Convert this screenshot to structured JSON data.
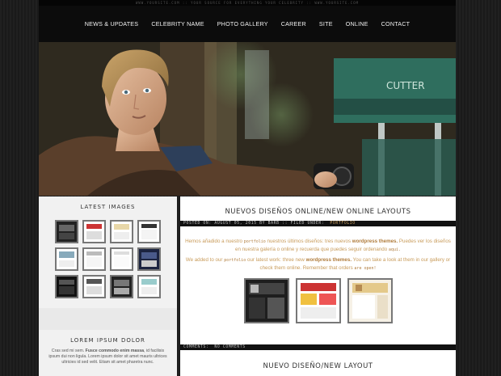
{
  "site": {
    "top_strip": "WWW.YOURSITE.COM :: YOUR SOURCE FOR EVERYTHING YOUR CELEBRITY :: WWW.YOURSITE.COM"
  },
  "nav": {
    "items": [
      {
        "label": "NEWS & UPDATES"
      },
      {
        "label": "CELEBRITY NAME"
      },
      {
        "label": "PHOTO GALLERY"
      },
      {
        "label": "CAREER"
      },
      {
        "label": "SITE"
      },
      {
        "label": "ONLINE"
      },
      {
        "label": "CONTACT"
      }
    ]
  },
  "header": {
    "chair_text": "CUTTER"
  },
  "sidebar": {
    "latest_images_title": "LATEST IMAGES",
    "lorem_title": "LOREM IPSUM DOLOR",
    "lorem_text_1": "Cras sed mi sem.",
    "lorem_text_bold": "Fusce commodo enim massa",
    "lorem_text_2": ", id facilisis ipsum dui non ligula. Lorem ipsum dolor sit amet mauris ultrices ultricies id sed velit. Etiam sit amet pharetra nunc."
  },
  "post1": {
    "title": "NUEVOS DISEÑOS ONLINE/NEW ONLINE LAYOUTS",
    "meta_prefix": "POSTED ON: AUGUST 05, 2015 BY BARB :: FILED UNDER:",
    "meta_category": "PORTFOLIO",
    "es_1": "Hemos añadido a nuestro",
    "es_link": "portfolio",
    "es_2": "nuestros últimos diseños: tres nuevos",
    "es_bold": "wordpress themes.",
    "es_3": "Puedes ver los diseños en nuestra galería o online y recuerda que puedes seguir ordenando",
    "es_link2": "aquí.",
    "en_1": "We added to our",
    "en_link": "portfolio",
    "en_2": "our latest work: three new",
    "en_bold": "wordpress themes.",
    "en_3": "You can take a look at them in our gallery or check them online. Remember that orders",
    "en_link2": "are open!",
    "comments_label": "COMMENTS:",
    "comments_value": "NO COMMENTS"
  },
  "post2": {
    "title": "NUEVO DISEÑO/NEW LAYOUT"
  },
  "colors": {
    "accent": "#c89b5a",
    "dark": "#111111"
  }
}
